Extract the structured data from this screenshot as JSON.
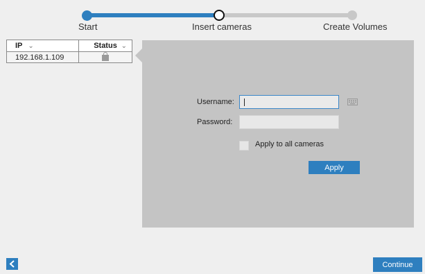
{
  "stepper": {
    "steps": [
      {
        "label": "Start",
        "state": "done"
      },
      {
        "label": "Insert cameras",
        "state": "current"
      },
      {
        "label": "Create Volumes",
        "state": "todo"
      }
    ]
  },
  "camera_table": {
    "columns": [
      {
        "label": "IP",
        "sort_icon": "chevron-down-icon"
      },
      {
        "label": "Status",
        "sort_icon": "chevron-down-icon"
      }
    ],
    "rows": [
      {
        "ip": "192.168.1.109",
        "status_icon": "lock-icon"
      }
    ]
  },
  "credentials": {
    "username_label": "Username:",
    "username_value": "",
    "password_label": "Password:",
    "password_value": "",
    "apply_all_label": "Apply to all cameras",
    "apply_all_checked": false,
    "apply_button": "Apply",
    "keyboard_icon": "keyboard-icon"
  },
  "navigation": {
    "back_icon": "chevron-left-icon",
    "continue_button": "Continue"
  },
  "colors": {
    "accent": "#2e7fbf",
    "panel": "#c4c4c4",
    "background": "#efefef"
  }
}
